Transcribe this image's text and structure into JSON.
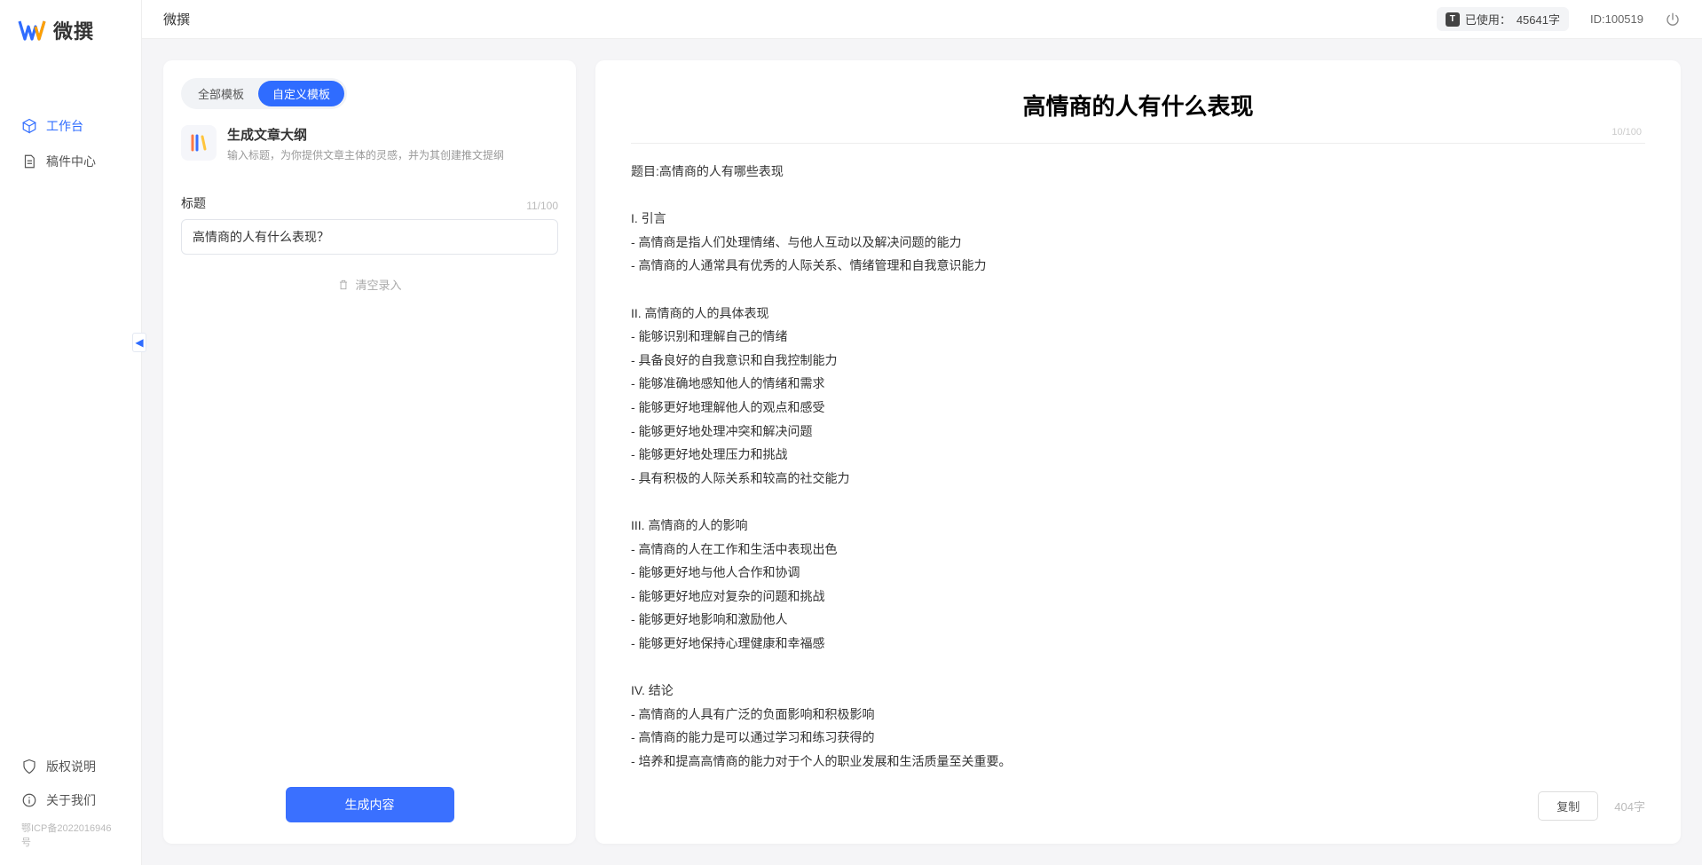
{
  "sidebar": {
    "logo_text": "微撰",
    "nav": [
      {
        "label": "工作台"
      },
      {
        "label": "稿件中心"
      }
    ],
    "footer": [
      {
        "label": "版权说明"
      },
      {
        "label": "关于我们"
      }
    ],
    "icp": "鄂ICP备2022016946号"
  },
  "topbar": {
    "title": "微撰",
    "usage_label": "已使用：",
    "usage_value": "45641字",
    "id_label": "ID:",
    "id_value": "100519"
  },
  "left_panel": {
    "tabs": [
      "全部模板",
      "自定义模板"
    ],
    "active_tab": 1,
    "template_name": "生成文章大纲",
    "template_desc": "输入标题，为你提供文章主体的灵感，并为其创建推文提纲",
    "field_label": "标题",
    "char_count": "11/100",
    "title_value": "高情商的人有什么表现？",
    "clear_label": "清空录入",
    "generate_label": "生成内容"
  },
  "right_panel": {
    "title": "高情商的人有什么表现",
    "title_count": "10/100",
    "body": "题目:高情商的人有哪些表现\n\nI. 引言\n- 高情商是指人们处理情绪、与他人互动以及解决问题的能力\n- 高情商的人通常具有优秀的人际关系、情绪管理和自我意识能力\n\nII. 高情商的人的具体表现\n- 能够识别和理解自己的情绪\n- 具备良好的自我意识和自我控制能力\n- 能够准确地感知他人的情绪和需求\n- 能够更好地理解他人的观点和感受\n- 能够更好地处理冲突和解决问题\n- 能够更好地处理压力和挑战\n- 具有积极的人际关系和较高的社交能力\n\nIII. 高情商的人的影响\n- 高情商的人在工作和生活中表现出色\n- 能够更好地与他人合作和协调\n- 能够更好地应对复杂的问题和挑战\n- 能够更好地影响和激励他人\n- 能够更好地保持心理健康和幸福感\n\nIV. 结论\n- 高情商的人具有广泛的负面影响和积极影响\n- 高情商的能力是可以通过学习和练习获得的\n- 培养和提高高情商的能力对于个人的职业发展和生活质量至关重要。",
    "copy_label": "复制",
    "word_count": "404字"
  }
}
